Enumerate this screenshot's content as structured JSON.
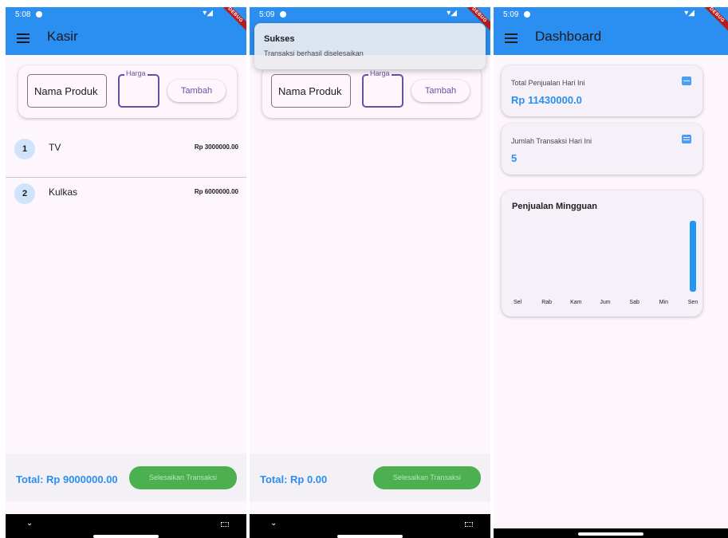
{
  "screen1": {
    "status_time": "5:08",
    "appbar_title": "Kasir",
    "form": {
      "nama_placeholder": "Nama Produk",
      "harga_label": "Harga",
      "tambah_label": "Tambah"
    },
    "items": [
      {
        "index": "1",
        "name": "TV",
        "price": "Rp 3000000.00"
      },
      {
        "index": "2",
        "name": "Kulkas",
        "price": "Rp 6000000.00"
      }
    ],
    "total": "Total: Rp 9000000.00",
    "selesai_label": "Selesaikan Transaksi",
    "debug_label": "DEBUG"
  },
  "screen2": {
    "status_time": "5:09",
    "snackbar": {
      "title": "Sukses",
      "message": "Transaksi berhasil diselesaikan"
    },
    "form": {
      "nama_placeholder": "Nama Produk",
      "harga_label": "Harga",
      "tambah_label": "Tambah"
    },
    "total": "Total: Rp 0.00",
    "selesai_label": "Selesaikan Transaksi",
    "debug_label": "DEBUG"
  },
  "screen3": {
    "status_time": "5:09",
    "appbar_title": "Dashboard",
    "total_penjualan": {
      "label": "Total Penjualan Hari Ini",
      "value": "Rp 11430000.0"
    },
    "jumlah_transaksi": {
      "label": "Jumlah Transaksi Hari Ini",
      "value": "5"
    },
    "chart_title": "Penjualan Mingguan",
    "debug_label": "DEBUG"
  },
  "colors": {
    "primary": "#2a8ff0",
    "accent_purple": "#6750a4",
    "success": "#4caf50"
  },
  "chart_data": {
    "type": "bar",
    "title": "Penjualan Mingguan",
    "categories": [
      "Sel",
      "Rab",
      "Kam",
      "Jum",
      "Sab",
      "Min",
      "Sen"
    ],
    "values": [
      0,
      0,
      0,
      0,
      0,
      0,
      11430000
    ],
    "ylim": [
      0,
      11430000
    ],
    "bar_color": "#2196f3",
    "grid": false,
    "legend": "none"
  }
}
